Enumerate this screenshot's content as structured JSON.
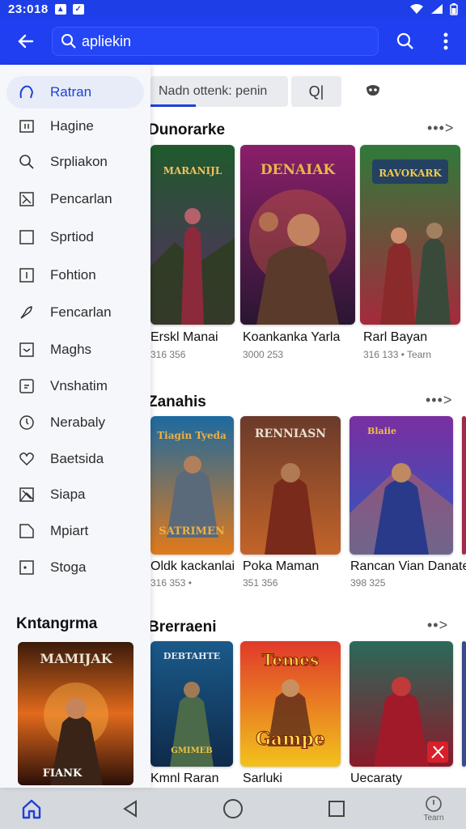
{
  "status_bar": {
    "time": "23:018",
    "icons": [
      "wifi-icon",
      "signal-icon",
      "battery-icon"
    ]
  },
  "app_bar": {
    "search_value": "apliekin",
    "icons": [
      "back-arrow-icon",
      "search-icon",
      "more-vert-icon"
    ]
  },
  "drawer": {
    "items": [
      {
        "label": "Ratran",
        "icon": "search-outline-icon",
        "active": true
      },
      {
        "label": "Hagine",
        "icon": "book-icon"
      },
      {
        "label": "Srpliakon",
        "icon": "search-icon"
      },
      {
        "label": "Pencarlan",
        "icon": "grid-icon"
      },
      {
        "label": "Sprtiod",
        "icon": "square-icon"
      },
      {
        "label": "Fohtion",
        "icon": "document-icon"
      },
      {
        "label": "Fencarlan",
        "icon": "brush-icon"
      },
      {
        "label": "Maghs",
        "icon": "box-icon"
      },
      {
        "label": "Vnshatim",
        "icon": "frame-icon"
      },
      {
        "label": "Nerabaly",
        "icon": "clock-icon"
      },
      {
        "label": "Baetsida",
        "icon": "heart-icon"
      },
      {
        "label": "Siapa",
        "icon": "image-icon"
      },
      {
        "label": "Mpiart",
        "icon": "tag-icon"
      },
      {
        "label": "Stoga",
        "icon": "storage-icon"
      }
    ],
    "section_title": "Kntangrma",
    "cover": {
      "title_art": "MAMIJAK",
      "caption_art": "FIANK",
      "accent": "#e26a1c"
    }
  },
  "tabs": {
    "tab1_label": "Nadn ottenk: penin",
    "tab2_label": "Q|",
    "tab3_icon": "mask-icon"
  },
  "shelves": [
    {
      "title": "Dunorarke",
      "more": "•••>",
      "items": [
        {
          "title": "Erskl Manai",
          "meta": "316 356",
          "art": "MARANIJL",
          "colors": [
            "#1f5a2c",
            "#5b2a66"
          ]
        },
        {
          "title": "Koankanka Yarla",
          "meta": "3000 253",
          "art": "DENAIAK",
          "colors": [
            "#8a1f6a",
            "#2a1632"
          ]
        },
        {
          "title": "Rarl Bayan",
          "meta": "316 133 • Tearn",
          "art": "RAVOKARK",
          "colors": [
            "#2f7a3a",
            "#a52a3c"
          ]
        }
      ]
    },
    {
      "title": "Zanahis",
      "more": "•••>",
      "items": [
        {
          "title": "Oldk kackanlai",
          "meta": "316 353 •",
          "art": "Tiagin Tyeda",
          "caption": "SATRIMEN",
          "colors": [
            "#1c6aa0",
            "#e07a1c"
          ]
        },
        {
          "title": "Poka Maman",
          "meta": "351 356",
          "art": "RENNIASN",
          "colors": [
            "#6b3a2a",
            "#c2642a"
          ]
        },
        {
          "title": "Rancan Vian Danate",
          "meta": "398 325",
          "art": "Blaiie",
          "colors": [
            "#7a2fa0",
            "#2a5ac0"
          ]
        }
      ]
    },
    {
      "title": "Brerraeni",
      "more": "••>",
      "items": [
        {
          "title": "Kmnl Raran",
          "meta": "",
          "art": "DEBTAHTE",
          "caption": "GMIMEB",
          "colors": [
            "#1a5a8a",
            "#0f2a4a"
          ]
        },
        {
          "title": "Sarluki",
          "meta": "",
          "art": "Temes",
          "caption": "Gampe",
          "colors": [
            "#e03a2a",
            "#f2c21c"
          ]
        },
        {
          "title": "Uecaraty",
          "meta": "",
          "art": "",
          "caption": "",
          "colors": [
            "#2a6a5a",
            "#8a1a2a"
          ]
        }
      ]
    }
  ],
  "bottom_nav": {
    "label": "Tearn",
    "icons": [
      "home-icon",
      "back-triangle-icon",
      "home-circle-icon",
      "recents-square-icon",
      "profile-circle-icon"
    ]
  },
  "colors": {
    "primary": "#1f3ff0",
    "drawer_bg": "#f6f7fb",
    "active_bg": "#e7ecf8",
    "active_text": "#1e40d8"
  }
}
